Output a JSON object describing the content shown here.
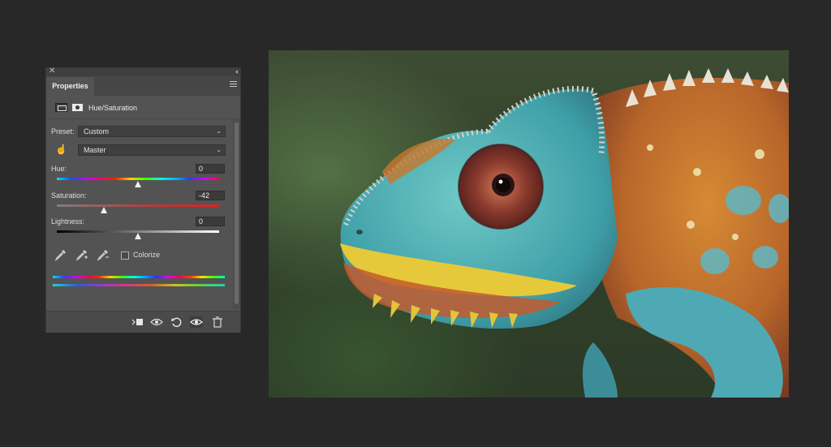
{
  "panel": {
    "tab_label": "Properties",
    "adjustment_title": "Hue/Saturation",
    "preset_label": "Preset:",
    "preset_value": "Custom",
    "channel_value": "Master",
    "hue_label": "Hue:",
    "hue_value": "0",
    "saturation_label": "Saturation:",
    "saturation_value": "-42",
    "lightness_label": "Lightness:",
    "lightness_value": "0",
    "colorize_label": "Colorize",
    "colorize_checked": false
  },
  "canvas": {
    "subject": "chameleon photo",
    "colors": {
      "skin_teal": "#4fb7bd",
      "skin_orange": "#c8772a",
      "mouth_yellow": "#e6c93a",
      "eye_red": "#8a3a2c"
    }
  },
  "icons": {
    "close": "close-icon",
    "collapse": "collapse-icon",
    "menu": "panel-menu-icon",
    "targeted_adjustment": "hand-icon",
    "eyedroppers": [
      "eyedropper-icon",
      "eyedropper-plus-icon",
      "eyedropper-minus-icon"
    ],
    "footer": [
      "clip-to-layer-icon",
      "view-previous-icon",
      "reset-icon",
      "visibility-icon",
      "trash-icon"
    ]
  }
}
